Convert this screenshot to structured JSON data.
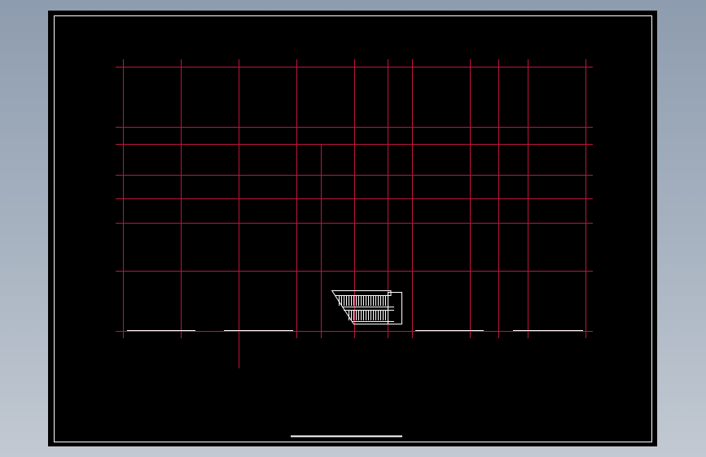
{
  "viewer": {
    "background_colors": [
      "#8d9cae",
      "#c2c9d2"
    ],
    "paper_color": "#000000",
    "border_color": "#ffffff"
  },
  "drawing": {
    "grid_color": "#c0143c",
    "detail_color": "#ffffff",
    "vertical_grid_line_count": 12,
    "horizontal_grid_line_count": 7,
    "has_title_bar": true
  }
}
